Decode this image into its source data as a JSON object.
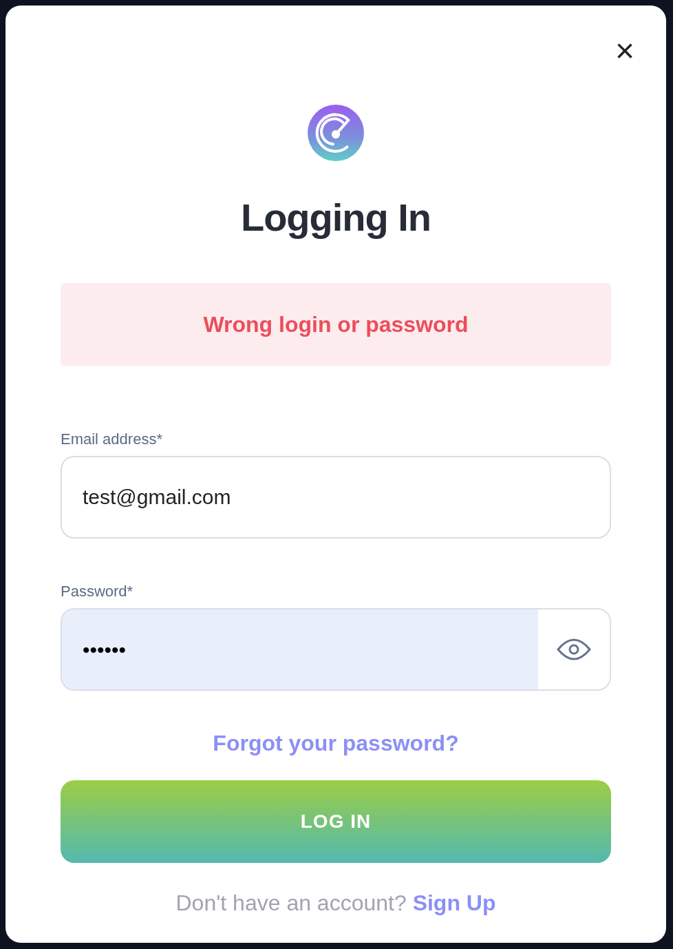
{
  "dialog": {
    "title": "Logging In",
    "close": "×"
  },
  "alert": {
    "text": "Wrong login or password"
  },
  "fields": [
    {
      "kind": "text",
      "label": "Email address*",
      "value": "test@gmail.com",
      "focused": false
    },
    {
      "kind": "password",
      "label": "Password*",
      "value": "••••••",
      "focused": true
    }
  ],
  "forgot_link": "Forgot your password?",
  "submit": "LOG IN",
  "footer": {
    "text": "Don't have an account?",
    "link": "Sign Up"
  }
}
